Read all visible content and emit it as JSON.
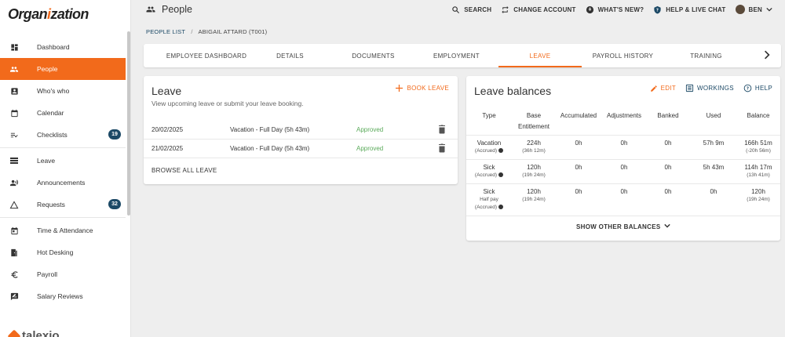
{
  "app": {
    "logo_prefix": "Organ",
    "logo_mark": "i",
    "logo_suffix": "zation",
    "page_title": "People",
    "footer_brand": "talexio"
  },
  "colors": {
    "accent": "#f26a1b",
    "badge": "#1c4966",
    "approved": "#5aaa5a"
  },
  "top_actions": [
    {
      "label": "SEARCH",
      "icon": "search-icon"
    },
    {
      "label": "CHANGE ACCOUNT",
      "icon": "swap-icon"
    },
    {
      "label": "WHAT'S NEW?",
      "icon": "rocket-icon"
    },
    {
      "label": "HELP & LIVE CHAT",
      "icon": "help-icon"
    },
    {
      "label": "BEN",
      "icon": "avatar"
    }
  ],
  "sidebar": {
    "items": [
      {
        "label": "Dashboard",
        "icon": "dashboard-icon",
        "active": false,
        "badge": ""
      },
      {
        "label": "People",
        "icon": "people-icon",
        "active": true,
        "badge": ""
      },
      {
        "label": "Who's who",
        "icon": "id-card-icon",
        "active": false,
        "badge": ""
      },
      {
        "label": "Calendar",
        "icon": "calendar-icon",
        "active": false,
        "badge": ""
      },
      {
        "label": "Checklists",
        "icon": "checklist-icon",
        "active": false,
        "badge": "19"
      },
      {
        "label": "Leave",
        "icon": "leave-icon",
        "active": false,
        "badge": ""
      },
      {
        "label": "Announcements",
        "icon": "announcement-icon",
        "active": false,
        "badge": ""
      },
      {
        "label": "Requests",
        "icon": "warning-icon",
        "active": false,
        "badge": "32"
      },
      {
        "label": "Time & Attendance",
        "icon": "calendar-clock-icon",
        "active": false,
        "badge": ""
      },
      {
        "label": "Hot Desking",
        "icon": "door-icon",
        "active": false,
        "badge": ""
      },
      {
        "label": "Payroll",
        "icon": "euro-icon",
        "active": false,
        "badge": ""
      },
      {
        "label": "Salary Reviews",
        "icon": "review-icon",
        "active": false,
        "badge": ""
      }
    ]
  },
  "breadcrumb": {
    "parent": "PEOPLE LIST",
    "current": "ABIGAIL ATTARD (T001)"
  },
  "tabs": [
    {
      "label": "EMPLOYEE DASHBOARD",
      "active": false
    },
    {
      "label": "DETAILS",
      "active": false
    },
    {
      "label": "DOCUMENTS",
      "active": false
    },
    {
      "label": "EMPLOYMENT",
      "active": false
    },
    {
      "label": "LEAVE",
      "active": true
    },
    {
      "label": "PAYROLL HISTORY",
      "active": false
    },
    {
      "label": "TRAINING",
      "active": false
    }
  ],
  "leave": {
    "title": "Leave",
    "subtitle": "View upcoming leave or submit your leave booking.",
    "book_label": "BOOK LEAVE",
    "rows": [
      {
        "date": "20/02/2025",
        "type": "Vacation - Full Day (5h 43m)",
        "status": "Approved"
      },
      {
        "date": "21/02/2025",
        "type": "Vacation - Full Day (5h 43m)",
        "status": "Approved"
      }
    ],
    "browse_label": "BROWSE ALL LEAVE"
  },
  "balances": {
    "title": "Leave balances",
    "edit_label": "EDIT",
    "workings_label": "WORKINGS",
    "help_label": "HELP",
    "headers": {
      "type": "Type",
      "base_1": "Base",
      "base_2": "Entitlement",
      "accumulated": "Accumulated",
      "adjustments": "Adjustments",
      "banked": "Banked",
      "used": "Used",
      "balance": "Balance"
    },
    "rows": [
      {
        "type": "Vacation",
        "type_extra": "",
        "type_note": "(Accrued)",
        "base": "224h",
        "base_sub": "(36h 12m)",
        "accumulated": "0h",
        "adjustments": "0h",
        "banked": "0h",
        "used": "57h 9m",
        "balance": "166h 51m",
        "balance_sub": "(-20h 56m)"
      },
      {
        "type": "Sick",
        "type_extra": "",
        "type_note": "(Accrued)",
        "base": "120h",
        "base_sub": "(19h 24m)",
        "accumulated": "0h",
        "adjustments": "0h",
        "banked": "0h",
        "used": "5h 43m",
        "balance": "114h 17m",
        "balance_sub": "(13h 41m)"
      },
      {
        "type": "Sick",
        "type_extra": "Half pay",
        "type_note": "(Accrued)",
        "base": "120h",
        "base_sub": "(19h 24m)",
        "accumulated": "0h",
        "adjustments": "0h",
        "banked": "0h",
        "used": "0h",
        "balance": "120h",
        "balance_sub": "(19h 24m)"
      }
    ],
    "show_other_label": "SHOW OTHER BALANCES"
  }
}
